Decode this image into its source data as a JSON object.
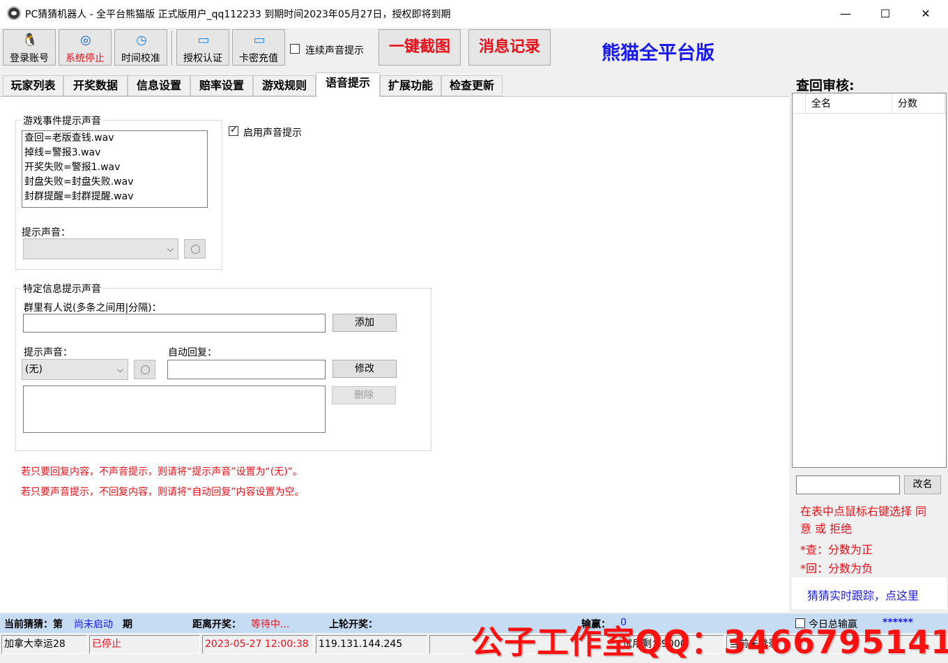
{
  "window": {
    "title": "PC猜猜机器人 - 全平台熊猫版 正式版用户_qq112233 到期时间2023年05月27日，授权即将到期",
    "minimize": "—",
    "maximize": "☐",
    "close": "✕"
  },
  "toolbar": {
    "login": "登录账号",
    "stop": "系统停止",
    "time_sync": "时间校准",
    "auth": "授权认证",
    "recharge": "卡密充值",
    "continuous_sound": "连续声音提示",
    "screenshot": "一键截图",
    "messages": "消息记录",
    "brand": "熊猫全平台版",
    "icons": {
      "login": "qq-penguin-icon",
      "stop": "target-icon",
      "time": "clock-icon",
      "auth": "card-icon",
      "recharge": "card-icon"
    }
  },
  "tabs": [
    "玩家列表",
    "开奖数据",
    "信息设置",
    "赔率设置",
    "游戏规则",
    "语音提示",
    "扩展功能",
    "检查更新"
  ],
  "active_tab": "语音提示",
  "events": {
    "title": "游戏事件提示声音",
    "items": [
      "查回=老版查钱.wav",
      "掉线=警报3.wav",
      "开奖失败=警报1.wav",
      "封盘失败=封盘失败.wav",
      "封群提醒=封群提醒.wav"
    ],
    "sound_label": "提示声音：",
    "sound_value": ""
  },
  "enable_sound": {
    "label": "启用声音提示",
    "checked": true
  },
  "specific": {
    "title": "特定信息提示声音",
    "someone_said_label": "群里有人说(多条之间用|分隔)：",
    "someone_said_value": "",
    "add": "添加",
    "sound_label": "提示声音：",
    "sound_value": "(无)",
    "auto_reply_label": "自动回复：",
    "auto_reply_value": "",
    "modify": "修改",
    "delete": "删除"
  },
  "notes": [
    "若只要回复内容，不声音提示，则请将“提示声音”设置为“(无)”。",
    "若只要声音提示，不回复内容，则请将“自动回复”内容设置为空。"
  ],
  "right": {
    "title": "查回审核:",
    "col_name": "全名",
    "col_score": "分数",
    "rename": "改名",
    "help1a": "在表中点鼠标右键选择 同",
    "help1b": "意 或 拒绝",
    "help2": "*查：分数为正",
    "help3": "*回：分数为负",
    "track": "猜猜实时跟踪，点这里"
  },
  "status1": {
    "current_label": "当前猜猜：第",
    "current_value": "尚未启动",
    "period": "期",
    "next_label": "距离开奖：",
    "next_value": "等待中...",
    "last_label": "上轮开奖：",
    "win_label": "输赢：",
    "win_value": "0",
    "today_label": "今日总输赢",
    "today_value": "******"
  },
  "status2": {
    "game": "加拿大幸运28",
    "state": "已停止",
    "datetime": "2023-05-27 12:00:38",
    "ip": "119.131.144.245",
    "cell5": "",
    "usage": "试用剩：9000",
    "login_state": "当前未登录"
  },
  "watermark": "公子工作室QQ：3466795141",
  "colors": {
    "accent_red": "#e8101a",
    "brand_blue": "#1a1aee",
    "status_blue": "#c6dcf3"
  }
}
